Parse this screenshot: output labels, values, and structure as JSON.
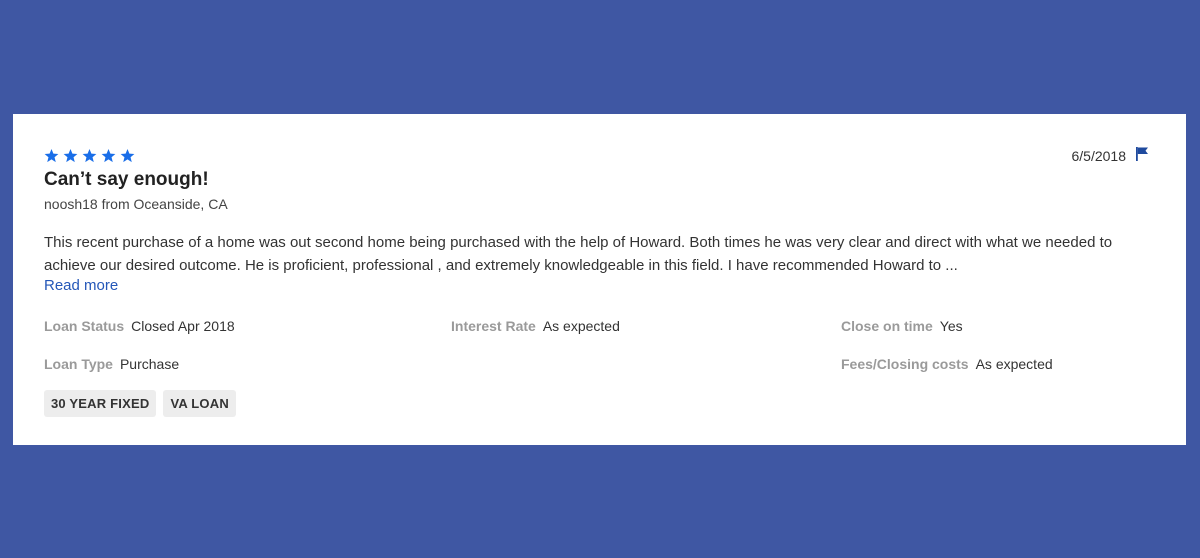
{
  "review": {
    "rating": 5,
    "rating_max": 5,
    "date": "6/5/2018",
    "title": "Can’t say enough!",
    "author": "noosh18 from Oceanside, CA",
    "body": "This recent purchase of a home was out second home being purchased with the help of Howard. Both times he was very clear and direct with what we needed to achieve our desired outcome. He is proficient, professional , and extremely knowledgeable in this field. I have recommended Howard to ...",
    "read_more": "Read more",
    "details": {
      "loan_status": {
        "label": "Loan Status",
        "value": "Closed Apr 2018"
      },
      "interest_rate": {
        "label": "Interest Rate",
        "value": "As expected"
      },
      "close_on_time": {
        "label": "Close on time",
        "value": "Yes"
      },
      "loan_type": {
        "label": "Loan Type",
        "value": "Purchase"
      },
      "fees": {
        "label": "Fees/Closing costs",
        "value": "As expected"
      }
    },
    "tags": [
      "30 YEAR FIXED",
      "VA LOAN"
    ]
  },
  "colors": {
    "background": "#3f57a3",
    "star": "#1a6ee8",
    "flag": "#1f4a9e",
    "link": "#2457b8"
  },
  "icons": {
    "star": "star-icon",
    "flag": "flag-icon"
  }
}
